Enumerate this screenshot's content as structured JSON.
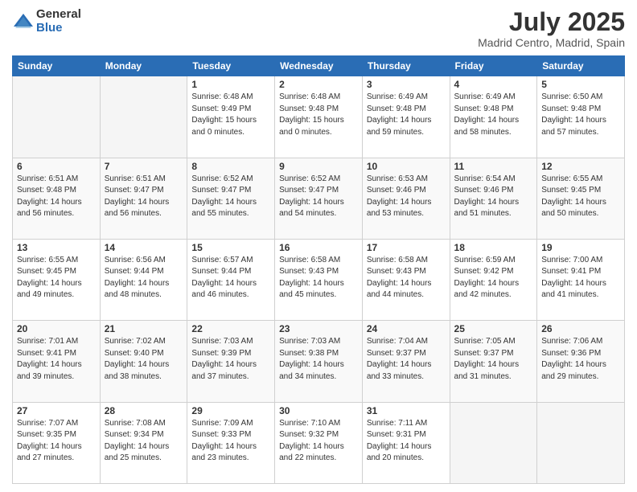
{
  "logo": {
    "general": "General",
    "blue": "Blue"
  },
  "title": "July 2025",
  "subtitle": "Madrid Centro, Madrid, Spain",
  "headers": [
    "Sunday",
    "Monday",
    "Tuesday",
    "Wednesday",
    "Thursday",
    "Friday",
    "Saturday"
  ],
  "weeks": [
    [
      {
        "day": "",
        "info": ""
      },
      {
        "day": "",
        "info": ""
      },
      {
        "day": "1",
        "info": "Sunrise: 6:48 AM\nSunset: 9:49 PM\nDaylight: 15 hours\nand 0 minutes."
      },
      {
        "day": "2",
        "info": "Sunrise: 6:48 AM\nSunset: 9:48 PM\nDaylight: 15 hours\nand 0 minutes."
      },
      {
        "day": "3",
        "info": "Sunrise: 6:49 AM\nSunset: 9:48 PM\nDaylight: 14 hours\nand 59 minutes."
      },
      {
        "day": "4",
        "info": "Sunrise: 6:49 AM\nSunset: 9:48 PM\nDaylight: 14 hours\nand 58 minutes."
      },
      {
        "day": "5",
        "info": "Sunrise: 6:50 AM\nSunset: 9:48 PM\nDaylight: 14 hours\nand 57 minutes."
      }
    ],
    [
      {
        "day": "6",
        "info": "Sunrise: 6:51 AM\nSunset: 9:48 PM\nDaylight: 14 hours\nand 56 minutes."
      },
      {
        "day": "7",
        "info": "Sunrise: 6:51 AM\nSunset: 9:47 PM\nDaylight: 14 hours\nand 56 minutes."
      },
      {
        "day": "8",
        "info": "Sunrise: 6:52 AM\nSunset: 9:47 PM\nDaylight: 14 hours\nand 55 minutes."
      },
      {
        "day": "9",
        "info": "Sunrise: 6:52 AM\nSunset: 9:47 PM\nDaylight: 14 hours\nand 54 minutes."
      },
      {
        "day": "10",
        "info": "Sunrise: 6:53 AM\nSunset: 9:46 PM\nDaylight: 14 hours\nand 53 minutes."
      },
      {
        "day": "11",
        "info": "Sunrise: 6:54 AM\nSunset: 9:46 PM\nDaylight: 14 hours\nand 51 minutes."
      },
      {
        "day": "12",
        "info": "Sunrise: 6:55 AM\nSunset: 9:45 PM\nDaylight: 14 hours\nand 50 minutes."
      }
    ],
    [
      {
        "day": "13",
        "info": "Sunrise: 6:55 AM\nSunset: 9:45 PM\nDaylight: 14 hours\nand 49 minutes."
      },
      {
        "day": "14",
        "info": "Sunrise: 6:56 AM\nSunset: 9:44 PM\nDaylight: 14 hours\nand 48 minutes."
      },
      {
        "day": "15",
        "info": "Sunrise: 6:57 AM\nSunset: 9:44 PM\nDaylight: 14 hours\nand 46 minutes."
      },
      {
        "day": "16",
        "info": "Sunrise: 6:58 AM\nSunset: 9:43 PM\nDaylight: 14 hours\nand 45 minutes."
      },
      {
        "day": "17",
        "info": "Sunrise: 6:58 AM\nSunset: 9:43 PM\nDaylight: 14 hours\nand 44 minutes."
      },
      {
        "day": "18",
        "info": "Sunrise: 6:59 AM\nSunset: 9:42 PM\nDaylight: 14 hours\nand 42 minutes."
      },
      {
        "day": "19",
        "info": "Sunrise: 7:00 AM\nSunset: 9:41 PM\nDaylight: 14 hours\nand 41 minutes."
      }
    ],
    [
      {
        "day": "20",
        "info": "Sunrise: 7:01 AM\nSunset: 9:41 PM\nDaylight: 14 hours\nand 39 minutes."
      },
      {
        "day": "21",
        "info": "Sunrise: 7:02 AM\nSunset: 9:40 PM\nDaylight: 14 hours\nand 38 minutes."
      },
      {
        "day": "22",
        "info": "Sunrise: 7:03 AM\nSunset: 9:39 PM\nDaylight: 14 hours\nand 37 minutes."
      },
      {
        "day": "23",
        "info": "Sunrise: 7:03 AM\nSunset: 9:38 PM\nDaylight: 14 hours\nand 34 minutes."
      },
      {
        "day": "24",
        "info": "Sunrise: 7:04 AM\nSunset: 9:37 PM\nDaylight: 14 hours\nand 33 minutes."
      },
      {
        "day": "25",
        "info": "Sunrise: 7:05 AM\nSunset: 9:37 PM\nDaylight: 14 hours\nand 31 minutes."
      },
      {
        "day": "26",
        "info": "Sunrise: 7:06 AM\nSunset: 9:36 PM\nDaylight: 14 hours\nand 29 minutes."
      }
    ],
    [
      {
        "day": "27",
        "info": "Sunrise: 7:07 AM\nSunset: 9:35 PM\nDaylight: 14 hours\nand 27 minutes."
      },
      {
        "day": "28",
        "info": "Sunrise: 7:08 AM\nSunset: 9:34 PM\nDaylight: 14 hours\nand 25 minutes."
      },
      {
        "day": "29",
        "info": "Sunrise: 7:09 AM\nSunset: 9:33 PM\nDaylight: 14 hours\nand 23 minutes."
      },
      {
        "day": "30",
        "info": "Sunrise: 7:10 AM\nSunset: 9:32 PM\nDaylight: 14 hours\nand 22 minutes."
      },
      {
        "day": "31",
        "info": "Sunrise: 7:11 AM\nSunset: 9:31 PM\nDaylight: 14 hours\nand 20 minutes."
      },
      {
        "day": "",
        "info": ""
      },
      {
        "day": "",
        "info": ""
      }
    ]
  ]
}
